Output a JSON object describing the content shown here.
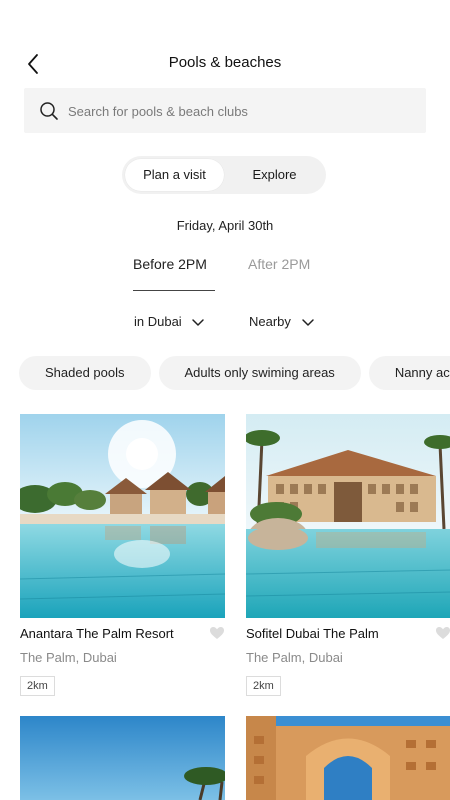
{
  "header": {
    "title": "Pools & beaches",
    "back_icon": "chevron-left-icon"
  },
  "search": {
    "placeholder": "Search for pools & beach clubs",
    "icon": "search-icon"
  },
  "segment": {
    "active": "Plan a visit",
    "other": "Explore"
  },
  "date": "Friday, April 30th",
  "time_tabs": {
    "active": "Before 2PM",
    "other": "After 2PM"
  },
  "dropdowns": {
    "location": "in Dubai",
    "sort": "Nearby"
  },
  "chips": [
    "Shaded pools",
    "Adults only swiming areas",
    "Nanny access"
  ],
  "cards": [
    {
      "name": "Anantara The Palm Resort",
      "location": "The Palm, Dubai",
      "distance": "2km"
    },
    {
      "name": "Sofitel Dubai The Palm",
      "location": "The Palm, Dubai",
      "distance": "2km"
    }
  ],
  "colors": {
    "pool": "#2fb8c9",
    "sky": "#bfe3f2",
    "chip_bg": "#f3f3f3",
    "search_bg": "#f4f4f4"
  }
}
